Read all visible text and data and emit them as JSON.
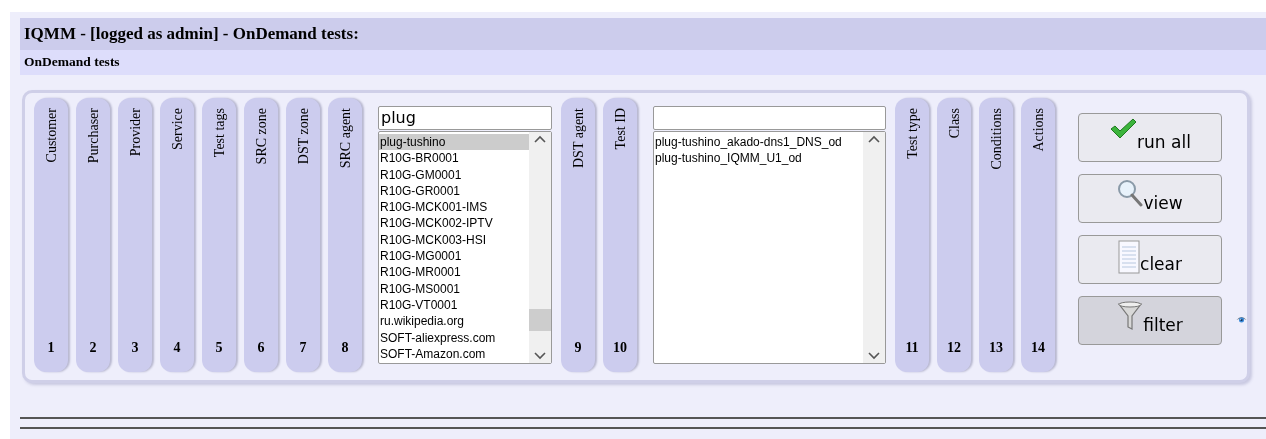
{
  "header": {
    "title": "IQMM - [logged as admin] - OnDemand tests:",
    "subtitle": "OnDemand tests"
  },
  "columns": [
    {
      "kind": "tab",
      "label": "Customer",
      "number": "1"
    },
    {
      "kind": "tab",
      "label": "Purchaser",
      "number": "2"
    },
    {
      "kind": "tab",
      "label": "Provider",
      "number": "3"
    },
    {
      "kind": "tab",
      "label": "Service",
      "number": "4"
    },
    {
      "kind": "tab",
      "label": "Test tags",
      "number": "5"
    },
    {
      "kind": "tab",
      "label": "SRC zone",
      "number": "6"
    },
    {
      "kind": "tab",
      "label": "DST zone",
      "number": "7"
    },
    {
      "kind": "tab",
      "label": "SRC agent",
      "number": "8"
    },
    {
      "kind": "list",
      "search": "plug",
      "items": [
        {
          "text": "plug-tushino",
          "selected": true
        },
        {
          "text": "R10G-BR0001",
          "selected": false
        },
        {
          "text": "R10G-GM0001",
          "selected": false
        },
        {
          "text": "R10G-GR0001",
          "selected": false
        },
        {
          "text": "R10G-MCK001-IMS",
          "selected": false
        },
        {
          "text": "R10G-MCK002-IPTV",
          "selected": false
        },
        {
          "text": "R10G-MCK003-HSI",
          "selected": false
        },
        {
          "text": "R10G-MG0001",
          "selected": false
        },
        {
          "text": "R10G-MR0001",
          "selected": false
        },
        {
          "text": "R10G-MS0001",
          "selected": false
        },
        {
          "text": "R10G-VT0001",
          "selected": false
        },
        {
          "text": "ru.wikipedia.org",
          "selected": false
        },
        {
          "text": "SOFT-aliexpress.com",
          "selected": false
        },
        {
          "text": "SOFT-Amazon.com",
          "selected": false
        }
      ]
    },
    {
      "kind": "tab",
      "label": "DST agent",
      "number": "9"
    },
    {
      "kind": "tab",
      "label": "Test ID",
      "number": "10"
    },
    {
      "kind": "list",
      "items": [
        {
          "text": "plug-tushino_akado-dns1_DNS_od",
          "selected": false
        },
        {
          "text": "plug-tushino_IQMM_U1_od",
          "selected": false
        }
      ]
    },
    {
      "kind": "tab",
      "label": "Test type",
      "number": "11"
    },
    {
      "kind": "tab",
      "label": "Class",
      "number": "12"
    },
    {
      "kind": "tab",
      "label": "Conditions",
      "number": "13"
    },
    {
      "kind": "tab",
      "label": "Actions",
      "number": "14"
    }
  ],
  "buttons": [
    {
      "kind": "check",
      "label": "run all",
      "pressed": false
    },
    {
      "kind": "search",
      "label": "view",
      "pressed": false
    },
    {
      "kind": "notepad",
      "label": "clear",
      "pressed": false
    },
    {
      "kind": "funnel",
      "label": "filter",
      "pressed": true
    }
  ]
}
